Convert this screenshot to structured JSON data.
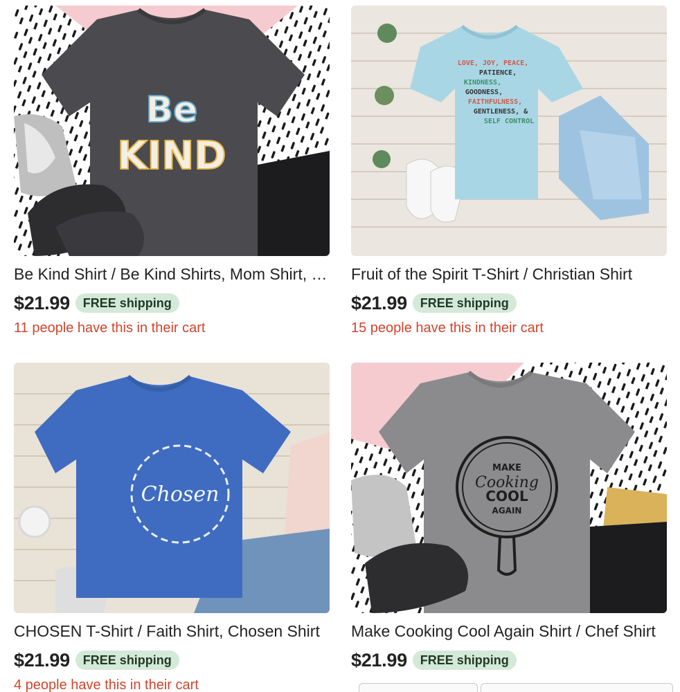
{
  "listings": [
    {
      "title": "Be Kind Shirt / Be Kind Shirts, Mom Shirt, Kindness Shirt",
      "price": "$21.99",
      "shipping": "FREE shipping",
      "cart_note": "11 people have this in their cart",
      "graphic_text": [
        "Be",
        "KIND"
      ]
    },
    {
      "title": "Fruit of the Spirit T-Shirt / Christian Shirt",
      "price": "$21.99",
      "shipping": "FREE shipping",
      "cart_note": "15 people have this in their cart",
      "graphic_text": [
        "LOVE, JOY, PEACE,",
        "PATIENCE,",
        "KINDNESS,",
        "GOODNESS,",
        "FAITHFULNESS,",
        "GENTLENESS, &",
        "SELF CONTROL"
      ]
    },
    {
      "title": "CHOSEN T-Shirt / Faith Shirt, Chosen Shirt",
      "price": "$21.99",
      "shipping": "FREE shipping",
      "cart_note": "4 people have this in their cart",
      "graphic_text": [
        "Chosen"
      ]
    },
    {
      "title": "Make Cooking Cool Again Shirt / Chef Shirt",
      "price": "$21.99",
      "shipping": "FREE shipping",
      "cart_note": "",
      "graphic_text": [
        "MAKE",
        "Cooking",
        "COOL",
        "AGAIN"
      ]
    }
  ],
  "colors": {
    "free_shipping_bg": "#d4e9d7",
    "cart_note": "#d2432a",
    "price": "#222222"
  }
}
